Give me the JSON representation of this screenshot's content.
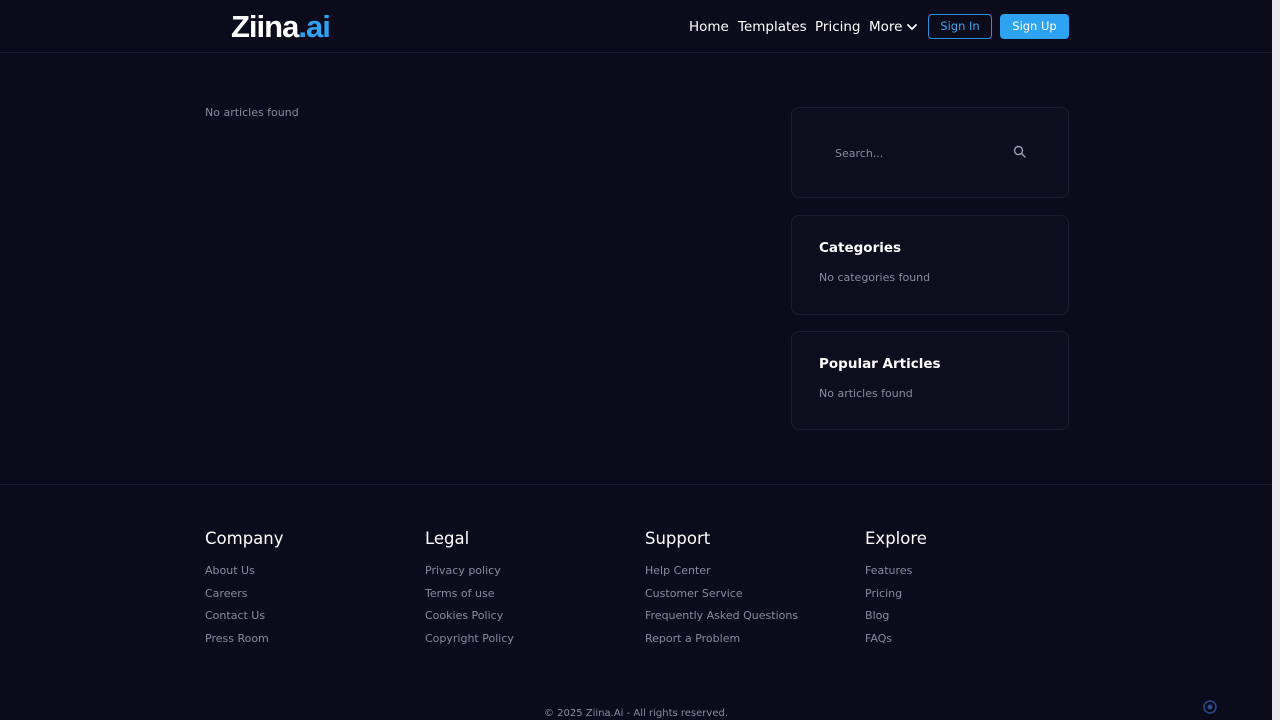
{
  "header": {
    "logo_main": "Ziina",
    "logo_suffix": ".ai",
    "nav": [
      {
        "label": "Home"
      },
      {
        "label": "Templates"
      },
      {
        "label": "Pricing"
      },
      {
        "label": "More"
      }
    ],
    "sign_in": "Sign In",
    "sign_up": "Sign Up"
  },
  "main": {
    "empty_message": "No articles found"
  },
  "sidebar": {
    "search_placeholder": "Search...",
    "categories": {
      "title": "Categories",
      "empty": "No categories found"
    },
    "popular": {
      "title": "Popular Articles",
      "empty": "No articles found"
    }
  },
  "footer": {
    "columns": [
      {
        "title": "Company",
        "links": [
          "About Us",
          "Careers",
          "Contact Us",
          "Press Room"
        ]
      },
      {
        "title": "Legal",
        "links": [
          "Privacy policy",
          "Terms of use",
          "Cookies Policy",
          "Copyright Policy"
        ]
      },
      {
        "title": "Support",
        "links": [
          "Help Center",
          "Customer Service",
          "Frequently Asked Questions",
          "Report a Problem"
        ]
      },
      {
        "title": "Explore",
        "links": [
          "Features",
          "Pricing",
          "Blog",
          "FAQs"
        ]
      }
    ],
    "copyright": "© 2025 Ziina.Ai - All rights reserved."
  },
  "colors": {
    "background": "#0c0b1b",
    "accent": "#2ea3f2",
    "muted_text": "#8a8a9c"
  },
  "icons": [
    "chevron-down-icon",
    "search-icon",
    "badge-icon"
  ]
}
